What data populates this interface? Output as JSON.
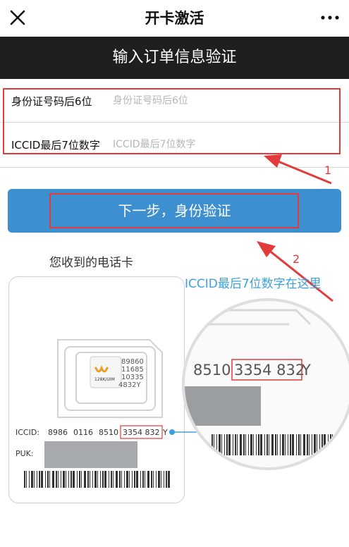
{
  "header": {
    "title": "开卡激活",
    "close_icon": "close-icon",
    "more_icon": "more-icon"
  },
  "banner": {
    "text": "输入订单信息验证"
  },
  "form": {
    "id_label": "身份证号码后6位",
    "id_placeholder": "身份证号码后6位",
    "iccid_label": "ICCID最后7位数字",
    "iccid_placeholder": "ICCID最后7位数字"
  },
  "next_button": {
    "label": "下一步，身份验证"
  },
  "annotations": {
    "callout_1": "1",
    "callout_2": "2",
    "color": "#e23b3b"
  },
  "illustration": {
    "caption": "您收到的电话卡",
    "iccid_hint": "ICCID最后7位数字在这里",
    "chip_numbers": [
      "89860",
      "11685",
      "10335",
      "4832Y"
    ],
    "chip_brand": "128K/UIM",
    "iccid_label": "ICCID:",
    "iccid_groups": [
      "8986",
      "0116",
      "8510"
    ],
    "iccid_highlight": "3354 832",
    "iccid_suffix": "Y",
    "puk_label": "PUK:",
    "magnified_prefix": "8510",
    "magnified_highlight": "3354  832",
    "magnified_suffix": "Y",
    "accent_color": "#3da0dd"
  }
}
